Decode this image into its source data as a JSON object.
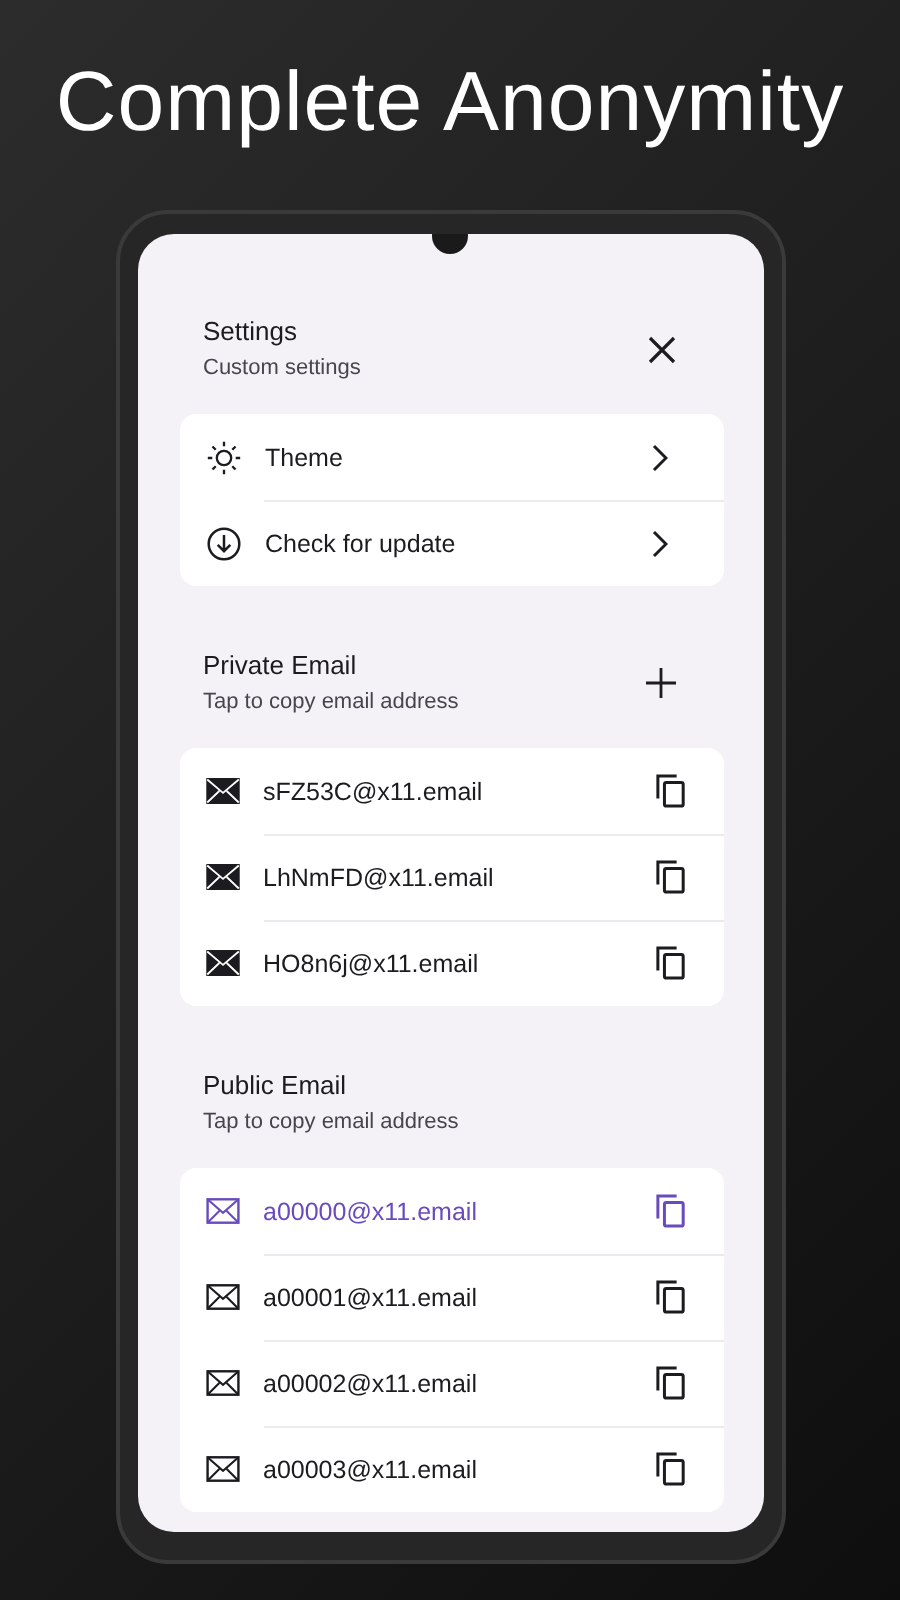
{
  "headline": "Complete Anonymity",
  "settings": {
    "title": "Settings",
    "subtitle": "Custom settings",
    "items": [
      {
        "kind": "theme",
        "label": "Theme"
      },
      {
        "kind": "update",
        "label": "Check for update"
      }
    ]
  },
  "sections": [
    {
      "kind": "filled",
      "title": "Private Email",
      "subtitle": "Tap to copy email address",
      "add_button": true,
      "emails": [
        {
          "address": "sFZ53C@x11.email",
          "selected": false
        },
        {
          "address": "LhNmFD@x11.email",
          "selected": false
        },
        {
          "address": "HO8n6j@x11.email",
          "selected": false
        }
      ]
    },
    {
      "kind": "outline",
      "title": "Public Email",
      "subtitle": "Tap to copy email address",
      "add_button": false,
      "emails": [
        {
          "address": "a00000@x11.email",
          "selected": true
        },
        {
          "address": "a00001@x11.email",
          "selected": false
        },
        {
          "address": "a00002@x11.email",
          "selected": false
        },
        {
          "address": "a00003@x11.email",
          "selected": false
        }
      ]
    }
  ]
}
